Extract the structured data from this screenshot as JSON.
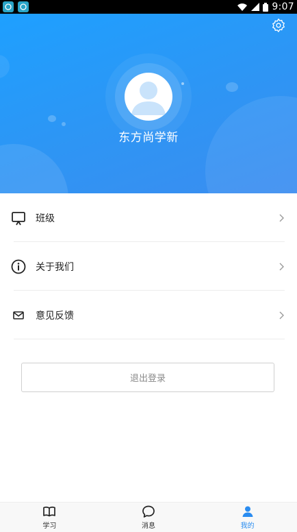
{
  "status_bar": {
    "time": "9:07"
  },
  "profile": {
    "name": "东方尚学新"
  },
  "menu": {
    "items": [
      {
        "label": "班级",
        "icon": "classroom-board-icon"
      },
      {
        "label": "关于我们",
        "icon": "info-icon"
      },
      {
        "label": "意见反馈",
        "icon": "mail-icon"
      }
    ]
  },
  "logout": {
    "label": "退出登录"
  },
  "nav": {
    "tabs": [
      {
        "label": "学习",
        "icon": "book-icon",
        "active": false
      },
      {
        "label": "消息",
        "icon": "chat-bubble-icon",
        "active": false
      },
      {
        "label": "我的",
        "icon": "person-icon",
        "active": true
      }
    ]
  },
  "colors": {
    "header_gradient_start": "#1ea0ff",
    "header_gradient_end": "#3b8df0",
    "accent": "#2a8cf0",
    "status_bar": "#000000"
  }
}
